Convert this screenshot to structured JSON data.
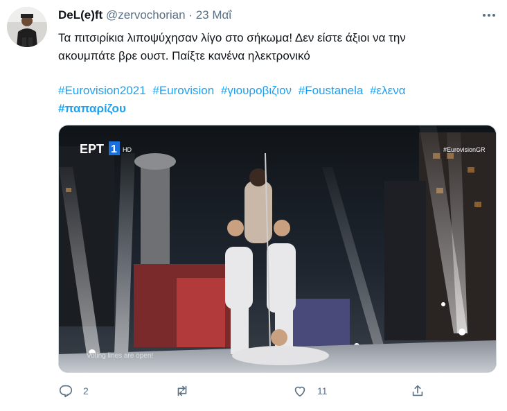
{
  "tweet": {
    "display_name": "DeL(e)ft",
    "handle": "@zervochorian",
    "separator": "·",
    "date": "23 Μαΐ",
    "text_line1": "Τα πιτσιρίκια λιποψύχησαν λίγο στο σήκωμα! Δεν είστε άξιοι να την",
    "text_line2": "ακουμπάτε βρε ουστ. Παίξτε κανένα ηλεκτρονικό",
    "hashtags": [
      "#Eurovision2021",
      "#Eurovision",
      "#γιουροβιζιον",
      "#Foustanela",
      "#ελενα"
    ],
    "hashtag_bold": "#παπαρίζου"
  },
  "media": {
    "channel_logo": "ΕΡΤ",
    "channel_number": "1",
    "channel_hd": "HD",
    "corner_tag": "#EurovisionGR",
    "caption": "Voting lines are open!"
  },
  "actions": {
    "reply": {
      "icon": "reply-icon",
      "count": "2"
    },
    "retweet": {
      "icon": "retweet-icon",
      "count": ""
    },
    "like": {
      "icon": "heart-icon",
      "count": "11"
    },
    "share": {
      "icon": "share-icon",
      "count": ""
    }
  },
  "colors": {
    "link": "#1da1f2",
    "muted": "#5b7083",
    "text": "#0f1419"
  }
}
